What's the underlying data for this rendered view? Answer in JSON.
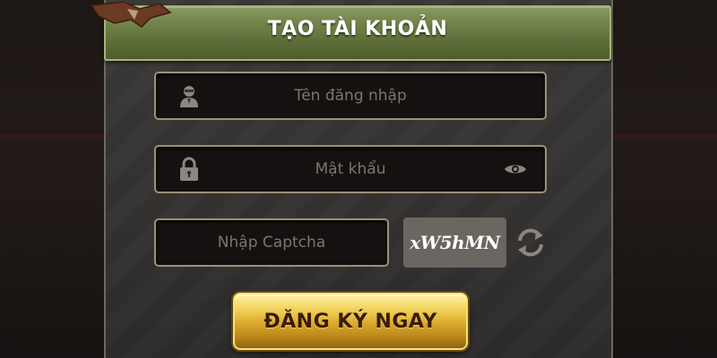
{
  "modal": {
    "title": "TẠO TÀI KHOẢN"
  },
  "form": {
    "username_placeholder": "Tên đăng nhập",
    "password_placeholder": "Mật khẩu",
    "captcha_placeholder": "Nhập Captcha",
    "captcha_code": "xW5hMN",
    "submit_label": "ĐĂNG KÝ NGAY"
  },
  "icons": {
    "username": "user-icon",
    "password": "lock-icon",
    "show_password": "eye-icon",
    "refresh_captcha": "refresh-icon",
    "decor": "wing-icon"
  },
  "colors": {
    "header_green": "#6f8048",
    "field_border": "#9c9272",
    "button_gold": "#d9a82a",
    "button_text": "#3a1d05"
  }
}
